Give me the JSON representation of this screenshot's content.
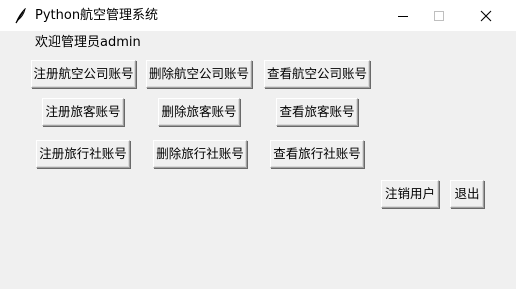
{
  "window": {
    "title": "Python航空管理系统",
    "icon": "feather-icon"
  },
  "title_controls": {
    "minimize_icon": "minimize-icon",
    "maximize_icon": "maximize-icon",
    "close_icon": "close-icon"
  },
  "welcome_text": "欢迎管理员admin",
  "buttons": {
    "register_airline": "注册航空公司账号",
    "delete_airline": "删除航空公司账号",
    "view_airline": "查看航空公司账号",
    "register_passenger": "注册旅客账号",
    "delete_passenger": "删除旅客账号",
    "view_passenger": "查看旅客账号",
    "register_agency": "注册旅行社账号",
    "delete_agency": "删除旅行社账号",
    "view_agency": "查看旅行社账号",
    "logout_user": "注销用户",
    "exit": "退出"
  }
}
